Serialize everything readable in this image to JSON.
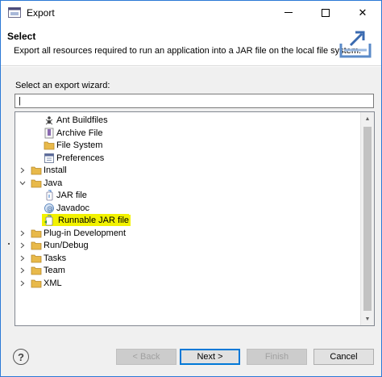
{
  "window": {
    "title": "Export",
    "minimize_icon": "minimize-icon",
    "maximize_icon": "maximize-icon",
    "close_icon": "close-icon",
    "close_glyph": "✕"
  },
  "header": {
    "title": "Select",
    "description": "Export all resources required to run an application into a JAR file on the local file system.",
    "icon": "export-jar-icon"
  },
  "wizard": {
    "label": "Select an export wizard:",
    "filter_value": "|",
    "tree": [
      {
        "label": "Ant Buildfiles",
        "icon": "ant-icon",
        "level": 2,
        "twisty": ""
      },
      {
        "label": "Archive File",
        "icon": "archive-icon",
        "level": 2,
        "twisty": ""
      },
      {
        "label": "File System",
        "icon": "folder-icon",
        "level": 2,
        "twisty": ""
      },
      {
        "label": "Preferences",
        "icon": "preferences-icon",
        "level": 2,
        "twisty": ""
      },
      {
        "label": "Install",
        "icon": "folder-icon",
        "level": 1,
        "twisty": ">"
      },
      {
        "label": "Java",
        "icon": "folder-icon",
        "level": 1,
        "twisty": "v"
      },
      {
        "label": "JAR file",
        "icon": "jar-icon",
        "level": 2,
        "twisty": ""
      },
      {
        "label": "Javadoc",
        "icon": "javadoc-icon",
        "level": 2,
        "twisty": ""
      },
      {
        "label": "Runnable JAR file",
        "icon": "runnable-jar-icon",
        "level": 2,
        "twisty": "",
        "highlighted": true
      },
      {
        "label": "Plug-in Development",
        "icon": "folder-icon",
        "level": 1,
        "twisty": ">"
      },
      {
        "label": "Run/Debug",
        "icon": "folder-icon",
        "level": 1,
        "twisty": ">"
      },
      {
        "label": "Tasks",
        "icon": "folder-icon",
        "level": 1,
        "twisty": ">"
      },
      {
        "label": "Team",
        "icon": "folder-icon",
        "level": 1,
        "twisty": ">"
      },
      {
        "label": "XML",
        "icon": "folder-icon",
        "level": 1,
        "twisty": ">"
      }
    ]
  },
  "footer": {
    "help_glyph": "?",
    "back_label": "< Back",
    "next_label": "Next >",
    "finish_label": "Finish",
    "cancel_label": "Cancel"
  },
  "colors": {
    "accent": "#0078d7",
    "highlight": "#f2f200",
    "folder": "#e8b94a"
  }
}
